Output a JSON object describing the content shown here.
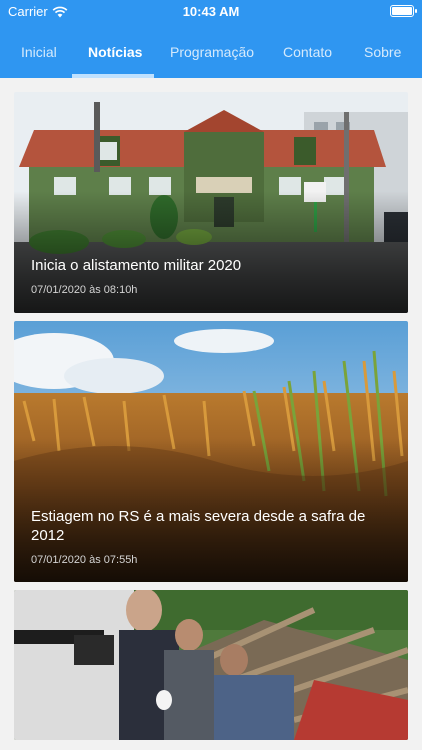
{
  "status_bar": {
    "carrier": "Carrier",
    "time": "10:43 AM",
    "battery_level": 1.0
  },
  "tabs": [
    {
      "label": "Inicial",
      "active": false
    },
    {
      "label": "Notícias",
      "active": true
    },
    {
      "label": "Programação",
      "active": false
    },
    {
      "label": "Contato",
      "active": false
    },
    {
      "label": "Sobre",
      "active": false
    }
  ],
  "news": [
    {
      "title": "Inicia o alistamento militar 2020",
      "date": "07/01/2020 às 08:10h",
      "image": "green-government-building-icon"
    },
    {
      "title": "Estiagem no RS é a mais severa desde a safra de 2012",
      "date": "07/01/2020 às 07:55h",
      "image": "dry-cornfield-icon"
    },
    {
      "title": "",
      "date": "",
      "image": "collapsed-house-rescue-icon"
    }
  ],
  "colors": {
    "header": "#2f96f1",
    "tab_indicator": "#bfe1ff",
    "background": "#f2f2f2"
  }
}
